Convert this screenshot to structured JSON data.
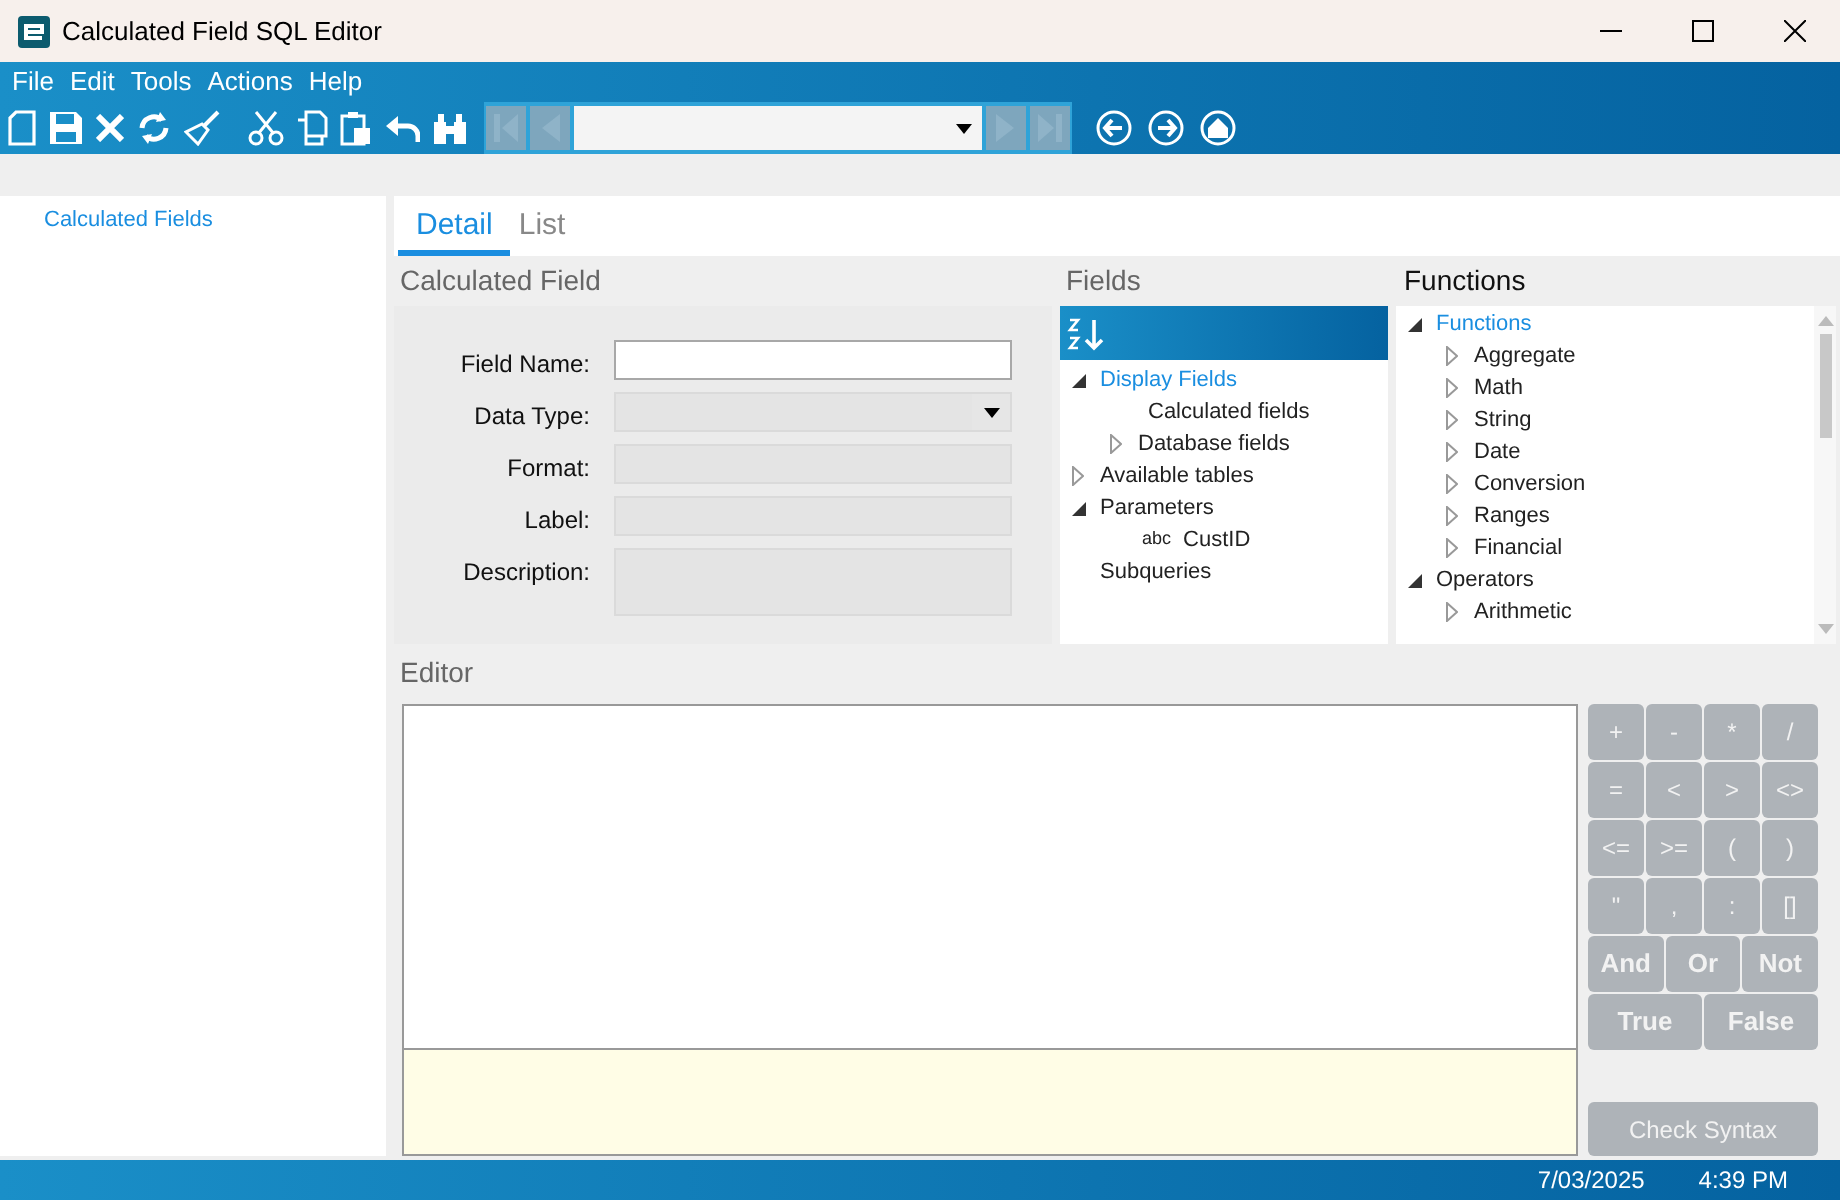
{
  "window": {
    "title": "Calculated Field SQL Editor"
  },
  "menu": [
    "File",
    "Edit",
    "Tools",
    "Actions",
    "Help"
  ],
  "toolbar": {
    "record_nav_disabled": true
  },
  "sidebar": {
    "items": [
      {
        "label": "Calculated Fields",
        "selected": true
      }
    ]
  },
  "tabs": [
    {
      "label": "Detail",
      "selected": true
    },
    {
      "label": "List",
      "selected": false
    }
  ],
  "calculated_field": {
    "title": "Calculated Field",
    "fields": [
      {
        "label": "Field Name:",
        "kind": "text",
        "disabled": false
      },
      {
        "label": "Data Type:",
        "kind": "dropdown",
        "disabled": true
      },
      {
        "label": "Format:",
        "kind": "text",
        "disabled": true
      },
      {
        "label": "Label:",
        "kind": "text",
        "disabled": true
      },
      {
        "label": "Description:",
        "kind": "textarea",
        "disabled": true
      }
    ]
  },
  "fields_panel": {
    "title": "Fields",
    "tree": [
      {
        "label": "Display Fields",
        "selected": true,
        "expanded": true,
        "children": [
          {
            "label": "Calculated fields",
            "selected": false
          },
          {
            "label": "Database fields",
            "selected": false,
            "expanded": false
          }
        ]
      },
      {
        "label": "Available tables",
        "selected": false,
        "expanded": false
      },
      {
        "label": "Parameters",
        "selected": false,
        "expanded": true,
        "children": [
          {
            "label": "CustID",
            "type_label": "abc",
            "selected": false
          }
        ]
      },
      {
        "label": "Subqueries",
        "selected": false
      }
    ]
  },
  "functions_panel": {
    "title": "Functions",
    "tree": [
      {
        "label": "Functions",
        "selected": true,
        "expanded": true,
        "children": [
          {
            "label": "Aggregate",
            "selected": false,
            "expanded": false
          },
          {
            "label": "Math",
            "selected": false,
            "expanded": false
          },
          {
            "label": "String",
            "selected": false,
            "expanded": false
          },
          {
            "label": "Date",
            "selected": false,
            "expanded": false
          },
          {
            "label": "Conversion",
            "selected": false,
            "expanded": false
          },
          {
            "label": "Ranges",
            "selected": false,
            "expanded": false
          },
          {
            "label": "Financial",
            "selected": false,
            "expanded": false
          }
        ]
      },
      {
        "label": "Operators",
        "selected": false,
        "expanded": true,
        "children": [
          {
            "label": "Arithmetic",
            "selected": false,
            "expanded": false
          }
        ]
      }
    ]
  },
  "editor": {
    "title": "Editor",
    "keypad": {
      "disabled": true,
      "operator_keys": [
        "+",
        "-",
        "*",
        "/",
        "=",
        "<",
        ">",
        "<>",
        "<=",
        ">=",
        "(",
        ")",
        "\"",
        ",",
        ":",
        "[]"
      ],
      "logic_keys": [
        "And",
        "Or",
        "Not"
      ],
      "boolean_keys": [
        "True",
        "False"
      ]
    },
    "check_syntax": {
      "label": "Check Syntax",
      "disabled": true
    }
  },
  "status_bar": {
    "date": "7/03/2025",
    "time": "4:39 PM"
  }
}
